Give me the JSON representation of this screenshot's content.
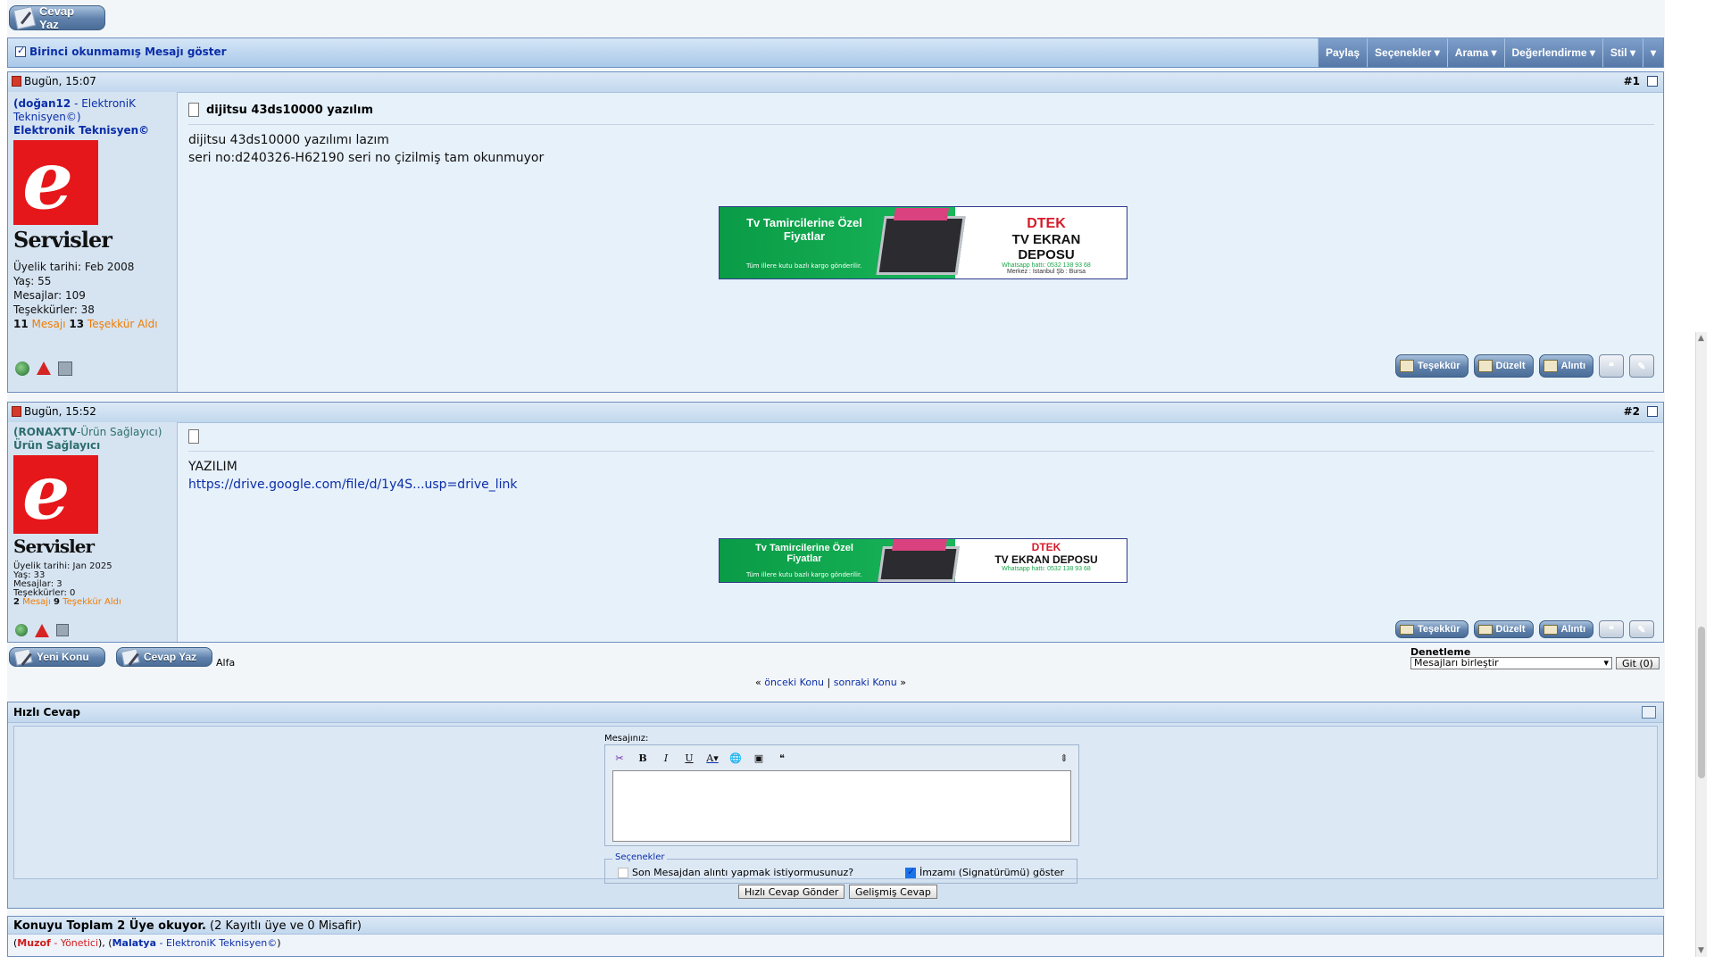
{
  "top": {
    "reply_button": "Cevap Yaz"
  },
  "navbar": {
    "show_first_unread": "Birinci okunmamış Mesajı göster",
    "menu": [
      "Paylaş",
      "Seçenekler",
      "Arama",
      "Değerlendirme",
      "Stil"
    ]
  },
  "posts": [
    {
      "date": "Bugün, 15:07",
      "number": "#1",
      "user_line1": "(doğan12",
      "user_line1b": " - ElektroniK",
      "user_line2": "Teknisyen©)",
      "user_title": "Elektronik Teknisyen©",
      "avatar_text": "Servisler",
      "join": "Üyelik tarihi: Feb 2008",
      "age": "Yaş: 55",
      "posts": "Mesajlar: 109",
      "thanks": "Teşekkürler: 38",
      "thanked_count": "11",
      "thanked_mid": "Mesajı",
      "thanked_count2": "13",
      "thanked_label": "Teşekkür Aldı",
      "title": "dijitsu 43ds10000 yazılım",
      "body1": "dijitsu 43ds10000 yazılımı lazım",
      "body2": "seri no:d240326-H62190 seri no çizilmiş tam okunmuyor"
    },
    {
      "date": "Bugün, 15:52",
      "number": "#2",
      "user_line1": "(RONAXTV",
      "user_line1b": "-Ürün Sağlayıcı)",
      "user_title": "Ürün Sağlayıcı",
      "avatar_text": "Servisler",
      "join": "Üyelik tarihi: Jan 2025",
      "age": "Yaş: 33",
      "posts": "Mesajlar: 3",
      "thanks": "Teşekkürler: 0",
      "thanked_count": "2",
      "thanked_mid": "Mesajı",
      "thanked_count2": "9",
      "thanked_label": "Teşekkür Aldı",
      "body1": "YAZILIM",
      "link": "https://drive.google.com/file/d/1y4S...usp=drive_link"
    }
  ],
  "ad": {
    "headline": "Tv Tamircilerine Özel Fiyatlar",
    "sub": "Tüm illere kutu bazlı kargo gönderilir.",
    "brand": "DTEK",
    "brand_sub": "TV EKRAN DEPOSU",
    "phone": "Whatsapp hattı: 0532 138 93 68",
    "address": "Merkez : İstanbul Şb : Bursa"
  },
  "post_actions": [
    "Teşekkür",
    "Düzelt",
    "Alıntı"
  ],
  "bottom": {
    "new_topic": "Yeni Konu",
    "reply": "Cevap Yaz",
    "alfa": "Alfa",
    "moderation_label": "Denetleme",
    "moderation_select": "Mesajları birleştir",
    "go_button": "Git (0)",
    "prev_topic": "önceki Konu",
    "separator": "|",
    "next_topic": "sonraki Konu",
    "left_quote": "«",
    "right_quote": "»"
  },
  "quick_reply": {
    "title": "Hızlı Cevap",
    "message_label": "Mesajınız:",
    "options_legend": "Seçenekler",
    "option_quote": "Son Mesajdan alıntı yapmak istiyormusunuz?",
    "option_signature": "İmzamı (Signatürümü) göster",
    "send_button": "Hızlı Cevap Gönder",
    "advanced_button": "Gelişmiş Cevap"
  },
  "who": {
    "title": "Konuyu Toplam 2 Üye okuyor.",
    "title_extra": " (2 Kayıtlı üye ve 0 Misafir)",
    "u1_name": "Muzof",
    "u1_role": "Yönetici",
    "u2_name": "Malatya",
    "u2_role": "ElektroniK Teknisyen©"
  },
  "colors": {
    "accent": "#0b2ea8",
    "orange": "#f07c00",
    "header_blue": "#a9c8e8"
  }
}
